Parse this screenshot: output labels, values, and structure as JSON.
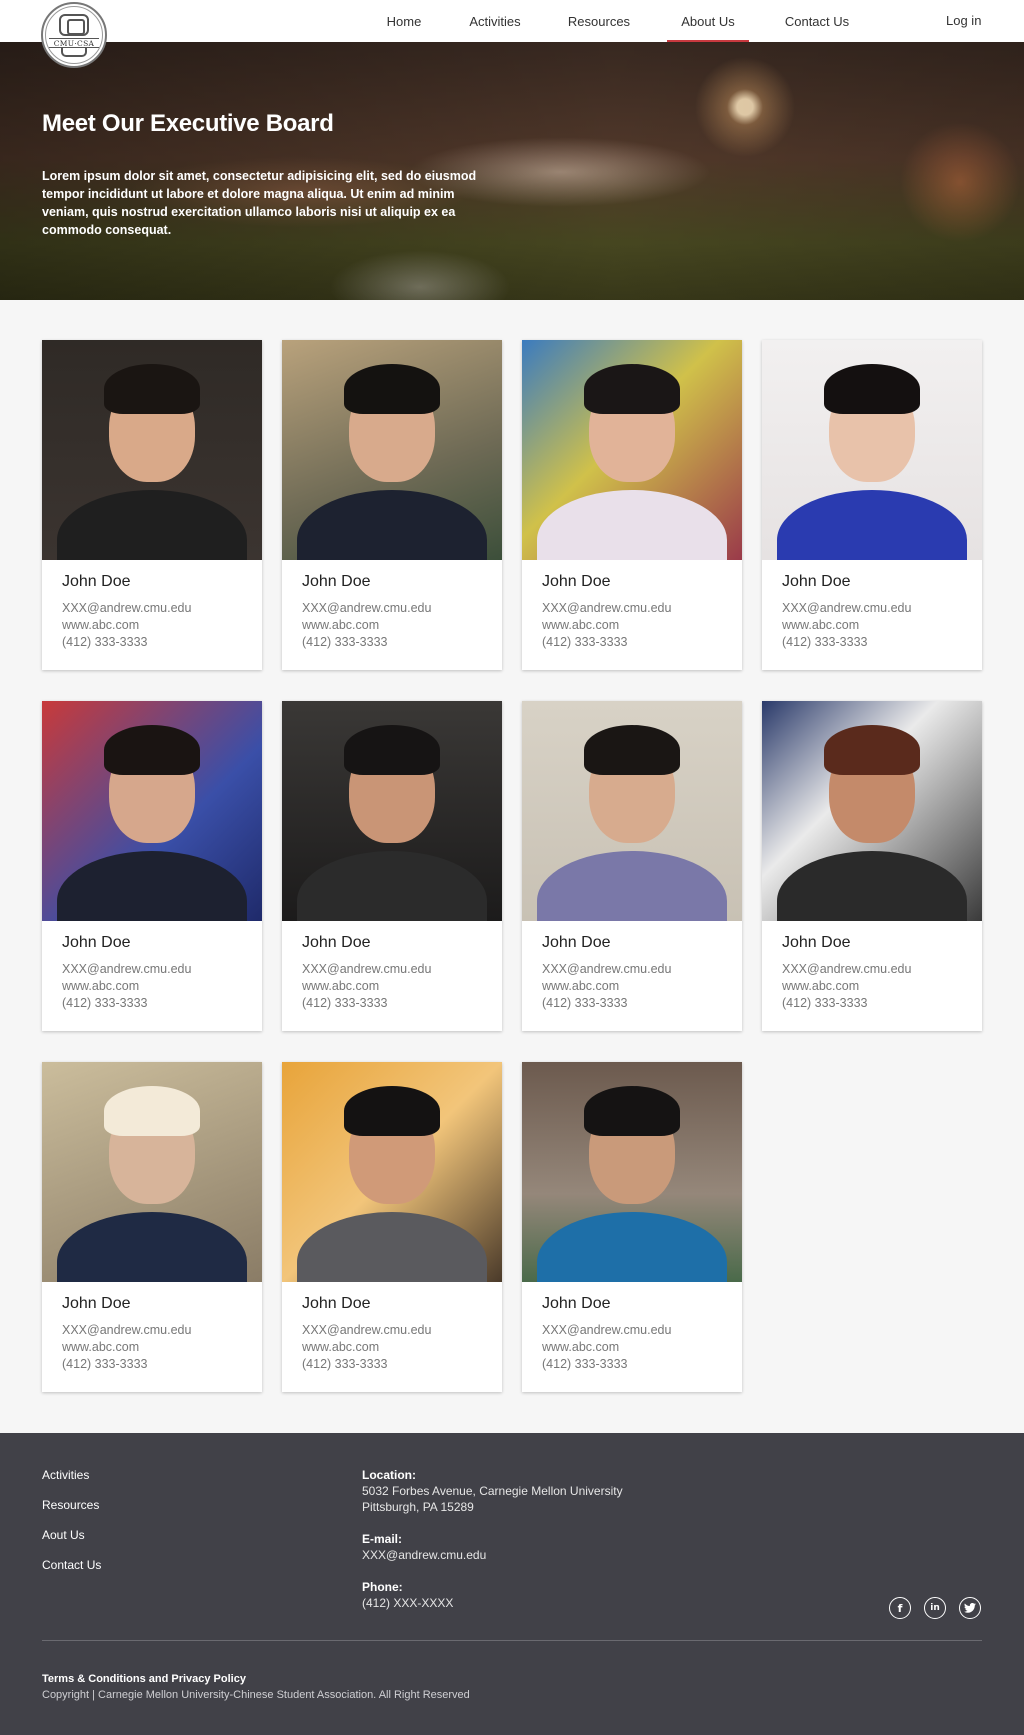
{
  "logo": {
    "text": "CMU·CSA"
  },
  "nav": {
    "items": [
      "Home",
      "Activities",
      "Resources",
      "About Us",
      "Contact Us"
    ],
    "active": "About Us",
    "login": "Log in"
  },
  "hero": {
    "title": "Meet Our Executive Board",
    "text": "Lorem ipsum dolor sit amet, consectetur adipisicing elit, sed do eiusmod tempor incididunt ut labore et dolore magna aliqua. Ut enim ad minim veniam, quis nostrud exercitation ullamco laboris nisi ut aliquip ex ea commodo consequat."
  },
  "members": [
    {
      "name": "John Doe",
      "email": "XXX@andrew.cmu.edu",
      "web": "www.abc.com",
      "phone": "(412) 333-3333"
    },
    {
      "name": "John Doe",
      "email": "XXX@andrew.cmu.edu",
      "web": "www.abc.com",
      "phone": "(412) 333-3333"
    },
    {
      "name": "John Doe",
      "email": "XXX@andrew.cmu.edu",
      "web": "www.abc.com",
      "phone": "(412) 333-3333"
    },
    {
      "name": "John Doe",
      "email": "XXX@andrew.cmu.edu",
      "web": "www.abc.com",
      "phone": "(412) 333-3333"
    },
    {
      "name": "John Doe",
      "email": "XXX@andrew.cmu.edu",
      "web": "www.abc.com",
      "phone": "(412) 333-3333"
    },
    {
      "name": "John Doe",
      "email": "XXX@andrew.cmu.edu",
      "web": "www.abc.com",
      "phone": "(412) 333-3333"
    },
    {
      "name": "John Doe",
      "email": "XXX@andrew.cmu.edu",
      "web": "www.abc.com",
      "phone": "(412) 333-3333"
    },
    {
      "name": "John Doe",
      "email": "XXX@andrew.cmu.edu",
      "web": "www.abc.com",
      "phone": "(412) 333-3333"
    },
    {
      "name": "John Doe",
      "email": "XXX@andrew.cmu.edu",
      "web": "www.abc.com",
      "phone": "(412) 333-3333"
    },
    {
      "name": "John Doe",
      "email": "XXX@andrew.cmu.edu",
      "web": "www.abc.com",
      "phone": "(412) 333-3333"
    },
    {
      "name": "John Doe",
      "email": "XXX@andrew.cmu.edu",
      "web": "www.abc.com",
      "phone": "(412) 333-3333"
    }
  ],
  "footer": {
    "links": [
      "Activities",
      "Resources",
      "Aout Us",
      "Contact Us"
    ],
    "location_label": "Location:",
    "location_line1": "5032 Forbes Avenue, Carnegie Mellon University",
    "location_line2": "Pittsburgh, PA 15289",
    "email_label": "E-mail:",
    "email": "XXX@andrew.cmu.edu",
    "phone_label": "Phone:",
    "phone": "(412) XXX-XXXX",
    "social_icons": [
      "facebook-icon",
      "linkedin-icon",
      "twitter-icon"
    ],
    "terms": "Terms & Conditions and Privacy Policy",
    "copyright": "Copyright |  Carnegie Mellon University-Chinese Student Association. All Right Reserved"
  },
  "colors": {
    "accent": "#c8393f",
    "footer_bg": "#414148",
    "page_bg": "#f6f6f6"
  }
}
